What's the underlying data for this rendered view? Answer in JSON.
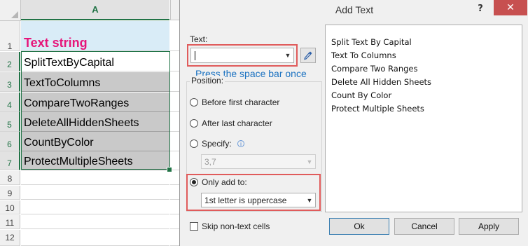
{
  "sheet": {
    "column_header": "A",
    "row_numbers": [
      "1",
      "2",
      "3",
      "4",
      "5",
      "6",
      "7",
      "8",
      "9",
      "10",
      "11",
      "12"
    ],
    "cells": [
      "Text string",
      "SplitTextByCapital",
      "TextToColumns",
      "CompareTwoRanges",
      "DeleteAllHiddenSheets",
      "CountByColor",
      "ProtectMultipleSheets"
    ]
  },
  "dialog": {
    "title": "Add Text",
    "help_label": "?",
    "close_label": "✕",
    "text_label": "Text:",
    "text_value": "",
    "hint": "Press the space bar once",
    "position_label": "Position:",
    "options": {
      "before_first": "Before first character",
      "after_last": "After last character",
      "specify": "Specify:",
      "specify_value": "3,7",
      "only_add_to": "Only add to:",
      "only_add_to_value": "1st letter is uppercase"
    },
    "selected_option": "only_add_to",
    "skip_non_text": "Skip non-text cells",
    "preview_items": [
      "Split Text By Capital",
      "Text To Columns",
      "Compare Two Ranges",
      "Delete All Hidden Sheets",
      "Count By Color",
      "Protect Multiple Sheets"
    ],
    "buttons": {
      "ok": "Ok",
      "cancel": "Cancel",
      "apply": "Apply"
    },
    "accent_color": "#e05b5b",
    "hint_color": "#1b72c1"
  }
}
